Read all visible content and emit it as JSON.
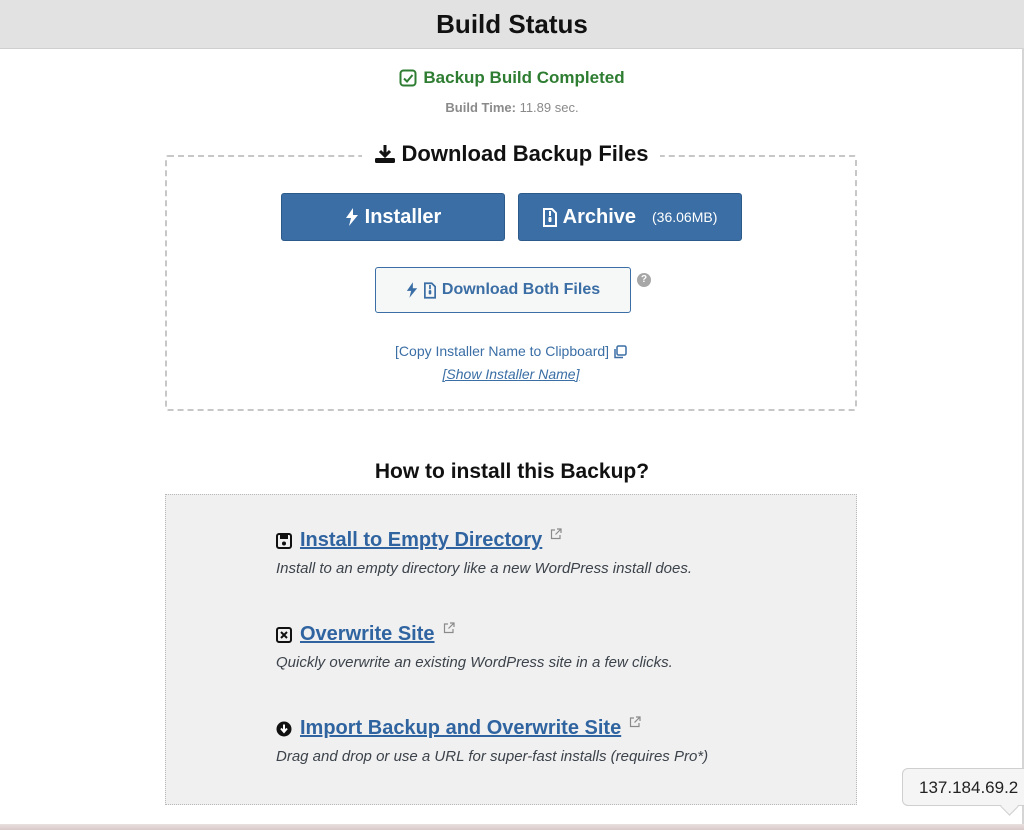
{
  "header": {
    "title": "Build Status"
  },
  "status": {
    "title": "Backup Build Completed",
    "build_time_label": "Build Time:",
    "build_time_value": "11.89 sec."
  },
  "download": {
    "heading": "Download Backup Files",
    "installer_label": "Installer",
    "archive_label": "Archive",
    "archive_size": "(36.06MB)",
    "both_label": "Download Both Files",
    "help": "?",
    "copy_link": "[Copy Installer Name to Clipboard]",
    "show_link": "[Show Installer Name]"
  },
  "install": {
    "heading": "How to install this Backup?",
    "options": [
      {
        "title": "Install to Empty Directory",
        "desc": "Install to an empty directory like a new WordPress install does.",
        "icon": "floppy-icon"
      },
      {
        "title": "Overwrite Site",
        "desc": "Quickly overwrite an existing WordPress site in a few clicks.",
        "icon": "x-square-icon"
      },
      {
        "title": "Import Backup and Overwrite Site",
        "desc": "Drag and drop or use a URL for super-fast installs (requires Pro*)",
        "icon": "download-circle-icon"
      }
    ]
  },
  "tooltip": {
    "text": "137.184.69.2"
  },
  "colors": {
    "primary": "#3a6ea5",
    "success": "#2e7d32",
    "panel": "#f0f0f1"
  }
}
